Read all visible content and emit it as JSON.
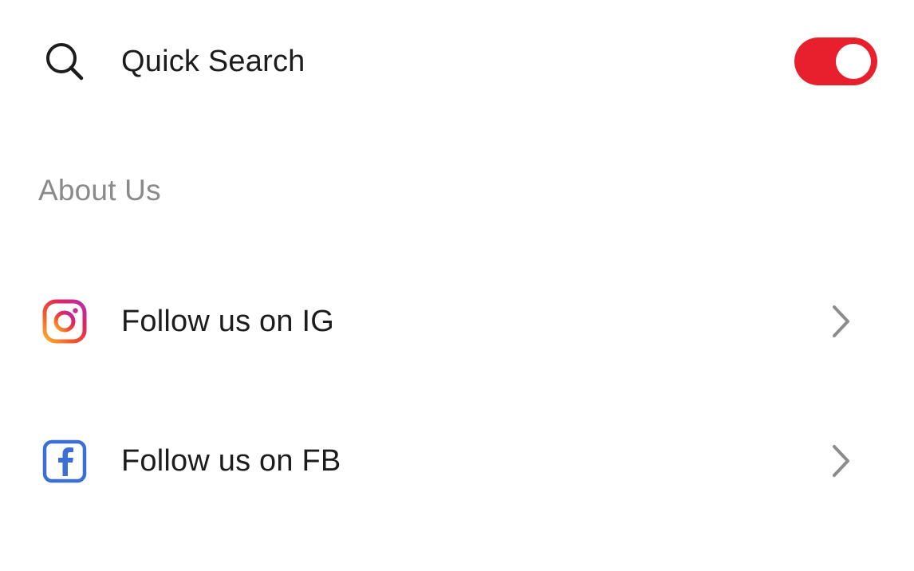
{
  "settings": {
    "quick_search": {
      "icon": "search-icon",
      "label": "Quick Search",
      "toggle_on": true,
      "toggle_color": "#e8202e"
    },
    "about_section": {
      "header": "About Us",
      "items": [
        {
          "icon": "instagram-icon",
          "label": "Follow us on IG",
          "trailing": "chevron-right-icon"
        },
        {
          "icon": "facebook-icon",
          "label": "Follow us on FB",
          "trailing": "chevron-right-icon"
        }
      ]
    }
  },
  "colors": {
    "text_primary": "#1c1c1c",
    "text_secondary": "#8a8a8a",
    "accent": "#e8202e",
    "facebook_blue": "#3b6fd6",
    "chevron_gray": "#8c8c8c"
  }
}
